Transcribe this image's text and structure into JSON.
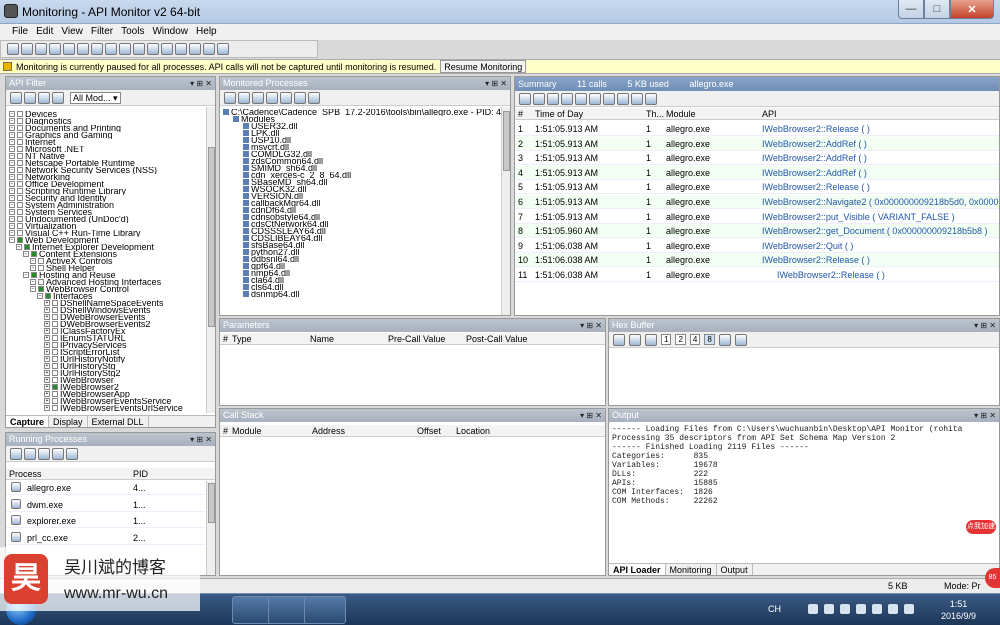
{
  "window": {
    "title": "Monitoring - API Monitor v2 64-bit",
    "min": "—",
    "max": "□",
    "close": "✕"
  },
  "menu": [
    "File",
    "Edit",
    "View",
    "Filter",
    "Tools",
    "Window",
    "Help"
  ],
  "info": {
    "message": "Monitoring is currently paused for all processes. API calls will not be captured until monitoring is resumed.",
    "resume": "Resume Monitoring"
  },
  "api_filter": {
    "title": "API Filter",
    "dropdown": "All Mod...",
    "items": [
      {
        "t": "Devices",
        "l": 0,
        "c": false
      },
      {
        "t": "Diagnostics",
        "l": 0,
        "c": false
      },
      {
        "t": "Documents and Printing",
        "l": 0,
        "c": false
      },
      {
        "t": "Graphics and Gaming",
        "l": 0,
        "c": false
      },
      {
        "t": "Internet",
        "l": 0,
        "c": false
      },
      {
        "t": "Microsoft .NET",
        "l": 0,
        "c": false
      },
      {
        "t": "NT Native",
        "l": 0,
        "c": false
      },
      {
        "t": "Netscape Portable Runtime",
        "l": 0,
        "c": false
      },
      {
        "t": "Network Security Services (NSS)",
        "l": 0,
        "c": false
      },
      {
        "t": "Networking",
        "l": 0,
        "c": false
      },
      {
        "t": "Office Development",
        "l": 0,
        "c": false
      },
      {
        "t": "Scripting Runtime Library",
        "l": 0,
        "c": false
      },
      {
        "t": "Security and Identity",
        "l": 0,
        "c": false
      },
      {
        "t": "System Administration",
        "l": 0,
        "c": false
      },
      {
        "t": "System Services",
        "l": 0,
        "c": false
      },
      {
        "t": "Undocumented (UnDoc'd)",
        "l": 0,
        "c": false
      },
      {
        "t": "Virtualization",
        "l": 0,
        "c": false
      },
      {
        "t": "Visual C++ Run-Time Library",
        "l": 0,
        "c": false
      },
      {
        "t": "Web Development",
        "l": 0,
        "c": true
      },
      {
        "t": "Internet Explorer Development",
        "l": 1,
        "c": true
      },
      {
        "t": "Content Extensions",
        "l": 2,
        "c": true
      },
      {
        "t": "ActiveX Controls",
        "l": 3,
        "c": false
      },
      {
        "t": "Shell Helper",
        "l": 3,
        "c": false
      },
      {
        "t": "Hosting and Reuse",
        "l": 2,
        "c": true
      },
      {
        "t": "Advanced Hosting Interfaces",
        "l": 3,
        "c": false
      },
      {
        "t": "WebBrowser Control",
        "l": 3,
        "c": true
      },
      {
        "t": "Interfaces",
        "l": 4,
        "c": true
      },
      {
        "t": "DShellNameSpaceEvents",
        "l": 5,
        "c": false
      },
      {
        "t": "DShellWindowsEvents",
        "l": 5,
        "c": false
      },
      {
        "t": "DWebBrowserEvents",
        "l": 5,
        "c": false
      },
      {
        "t": "DWebBrowserEvents2",
        "l": 5,
        "c": false
      },
      {
        "t": "IClassFactoryEx",
        "l": 5,
        "c": false
      },
      {
        "t": "IEnumSTATURL",
        "l": 5,
        "c": false
      },
      {
        "t": "IPrivacyServices",
        "l": 5,
        "c": false
      },
      {
        "t": "IScriptErrorList",
        "l": 5,
        "c": false
      },
      {
        "t": "IUrlHistoryNotify",
        "l": 5,
        "c": false
      },
      {
        "t": "IUrlHistoryStg",
        "l": 5,
        "c": false
      },
      {
        "t": "IUrlHistoryStg2",
        "l": 5,
        "c": false
      },
      {
        "t": "IWebBrowser",
        "l": 5,
        "c": false
      },
      {
        "t": "IWebBrowser2",
        "l": 5,
        "c": true
      },
      {
        "t": "IWebBrowserApp",
        "l": 5,
        "c": false
      },
      {
        "t": "IWebBrowserEventsService",
        "l": 5,
        "c": false
      },
      {
        "t": "IWebBrowserEventsUrlService",
        "l": 5,
        "c": false
      }
    ],
    "tabs": [
      "Capture",
      "Display",
      "External DLL"
    ]
  },
  "monitored": {
    "title": "Monitored Processes",
    "items": [
      {
        "t": "C:\\Cadence\\Cadence_SPB_17.2-2016\\tools\\bin\\allegro.exe - PID: 4!",
        "l": 0
      },
      {
        "t": "Modules",
        "l": 1
      },
      {
        "t": "USER32.dll",
        "l": 2
      },
      {
        "t": "LPK.dll",
        "l": 2
      },
      {
        "t": "USP10.dll",
        "l": 2
      },
      {
        "t": "msvcrt.dll",
        "l": 2
      },
      {
        "t": "COMDLG32.dll",
        "l": 2
      },
      {
        "t": "zdsCommon64.dll",
        "l": 2
      },
      {
        "t": "SMIMD_sh64.dll",
        "l": 2
      },
      {
        "t": "cdn_xerces-c_2_8_64.dll",
        "l": 2
      },
      {
        "t": "SBaseMD_sh64.dll",
        "l": 2
      },
      {
        "t": "WSOCK32.dll",
        "l": 2
      },
      {
        "t": "VERSION.dll",
        "l": 2
      },
      {
        "t": "callbackMgr64.dll",
        "l": 2
      },
      {
        "t": "cdnDf64.dll",
        "l": 2
      },
      {
        "t": "cdnsobstyle64.dll",
        "l": 2
      },
      {
        "t": "cdsCtNetwork64.dll",
        "l": 2
      },
      {
        "t": "CDSSSLEAY64.dll",
        "l": 2
      },
      {
        "t": "CDSLIBEAY64.dll",
        "l": 2
      },
      {
        "t": "sfsBase64.dll",
        "l": 2
      },
      {
        "t": "python27.dll",
        "l": 2
      },
      {
        "t": "ddbsnl64.dll",
        "l": 2
      },
      {
        "t": "gpf64.dll",
        "l": 2
      },
      {
        "t": "nmp64.dll",
        "l": 2
      },
      {
        "t": "cla64.dll",
        "l": 2
      },
      {
        "t": "cls64.dll",
        "l": 2
      },
      {
        "t": "dsnmp64.dll",
        "l": 2
      }
    ]
  },
  "summary": {
    "label": "Summary",
    "calls": "11 calls",
    "used": "5 KB used",
    "process": "allegro.exe",
    "headers": [
      "#",
      "Time of Day",
      "Th...",
      "Module",
      "API"
    ],
    "rows": [
      {
        "n": "1",
        "time": "1:51:05.913 AM",
        "th": "1",
        "mod": "allegro.exe",
        "api": "IWebBrowser2::Release ( )",
        "ind": false
      },
      {
        "n": "2",
        "time": "1:51:05.913 AM",
        "th": "1",
        "mod": "allegro.exe",
        "api": "IWebBrowser2::AddRef ( )",
        "ind": false
      },
      {
        "n": "3",
        "time": "1:51:05.913 AM",
        "th": "1",
        "mod": "allegro.exe",
        "api": "IWebBrowser2::AddRef ( )",
        "ind": false
      },
      {
        "n": "4",
        "time": "1:51:05.913 AM",
        "th": "1",
        "mod": "allegro.exe",
        "api": "IWebBrowser2::AddRef ( )",
        "ind": false
      },
      {
        "n": "5",
        "time": "1:51:05.913 AM",
        "th": "1",
        "mod": "allegro.exe",
        "api": "IWebBrowser2::Release ( )",
        "ind": false
      },
      {
        "n": "6",
        "time": "1:51:05.913 AM",
        "th": "1",
        "mod": "allegro.exe",
        "api": "IWebBrowser2::Navigate2 ( 0x000000009218b5d0, 0x00000000",
        "ind": false
      },
      {
        "n": "7",
        "time": "1:51:05.913 AM",
        "th": "1",
        "mod": "allegro.exe",
        "api": "IWebBrowser2::put_Visible ( VARIANT_FALSE )",
        "ind": false
      },
      {
        "n": "8",
        "time": "1:51:05.960 AM",
        "th": "1",
        "mod": "allegro.exe",
        "api": "IWebBrowser2::get_Document ( 0x000000009218b5b8 )",
        "ind": false
      },
      {
        "n": "9",
        "time": "1:51:06.038 AM",
        "th": "1",
        "mod": "allegro.exe",
        "api": "IWebBrowser2::Quit ( )",
        "ind": false
      },
      {
        "n": "10",
        "time": "1:51:06.038 AM",
        "th": "1",
        "mod": "allegro.exe",
        "api": "IWebBrowser2::Release ( )",
        "ind": false
      },
      {
        "n": "11",
        "time": "1:51:06.038 AM",
        "th": "1",
        "mod": "allegro.exe",
        "api": "IWebBrowser2::Release ( )",
        "ind": true
      }
    ]
  },
  "parameters": {
    "title": "Parameters",
    "headers": [
      "#",
      "Type",
      "Name",
      "Pre-Call Value",
      "Post-Call Value"
    ]
  },
  "hex": {
    "title": "Hex Buffer",
    "btns": [
      "1",
      "2",
      "4",
      "8"
    ]
  },
  "callstack": {
    "title": "Call Stack",
    "headers": [
      "#",
      "Module",
      "Address",
      "Offset",
      "Location"
    ]
  },
  "output": {
    "title": "Output",
    "lines": [
      "------ Loading Files from C:\\Users\\wuchuanbin\\Desktop\\API Monitor (rohita",
      "Processing 35 descriptors from API Set Schema Map Version 2",
      "------ Finished Loading 2119 Files ------",
      "Categories:      835",
      "Variables:       19678",
      "DLLs:            222",
      "APIs:            15885",
      "COM Interfaces:  1826",
      "COM Methods:     22262"
    ],
    "tabs": [
      "API Loader",
      "Monitoring",
      "Output"
    ]
  },
  "running": {
    "title": "Running Processes",
    "headers": [
      "Process",
      "PID"
    ],
    "rows": [
      {
        "p": "allegro.exe",
        "pid": "4..."
      },
      {
        "p": "dwm.exe",
        "pid": "1..."
      },
      {
        "p": "explorer.exe",
        "pid": "1..."
      },
      {
        "p": "prl_cc.exe",
        "pid": "2..."
      }
    ]
  },
  "status": {
    "left": "Ra",
    "size": "5 KB",
    "mode": "Mode: Pr"
  },
  "taskbar": {
    "time": "1:51",
    "date": "2016/9/9",
    "lang": "CH"
  },
  "watermark": {
    "name": "吴川斌的博客",
    "url": "www.mr-wu.cn",
    "logo": "昊"
  },
  "badges": {
    "b1": "点我加速",
    "b2": "85"
  }
}
